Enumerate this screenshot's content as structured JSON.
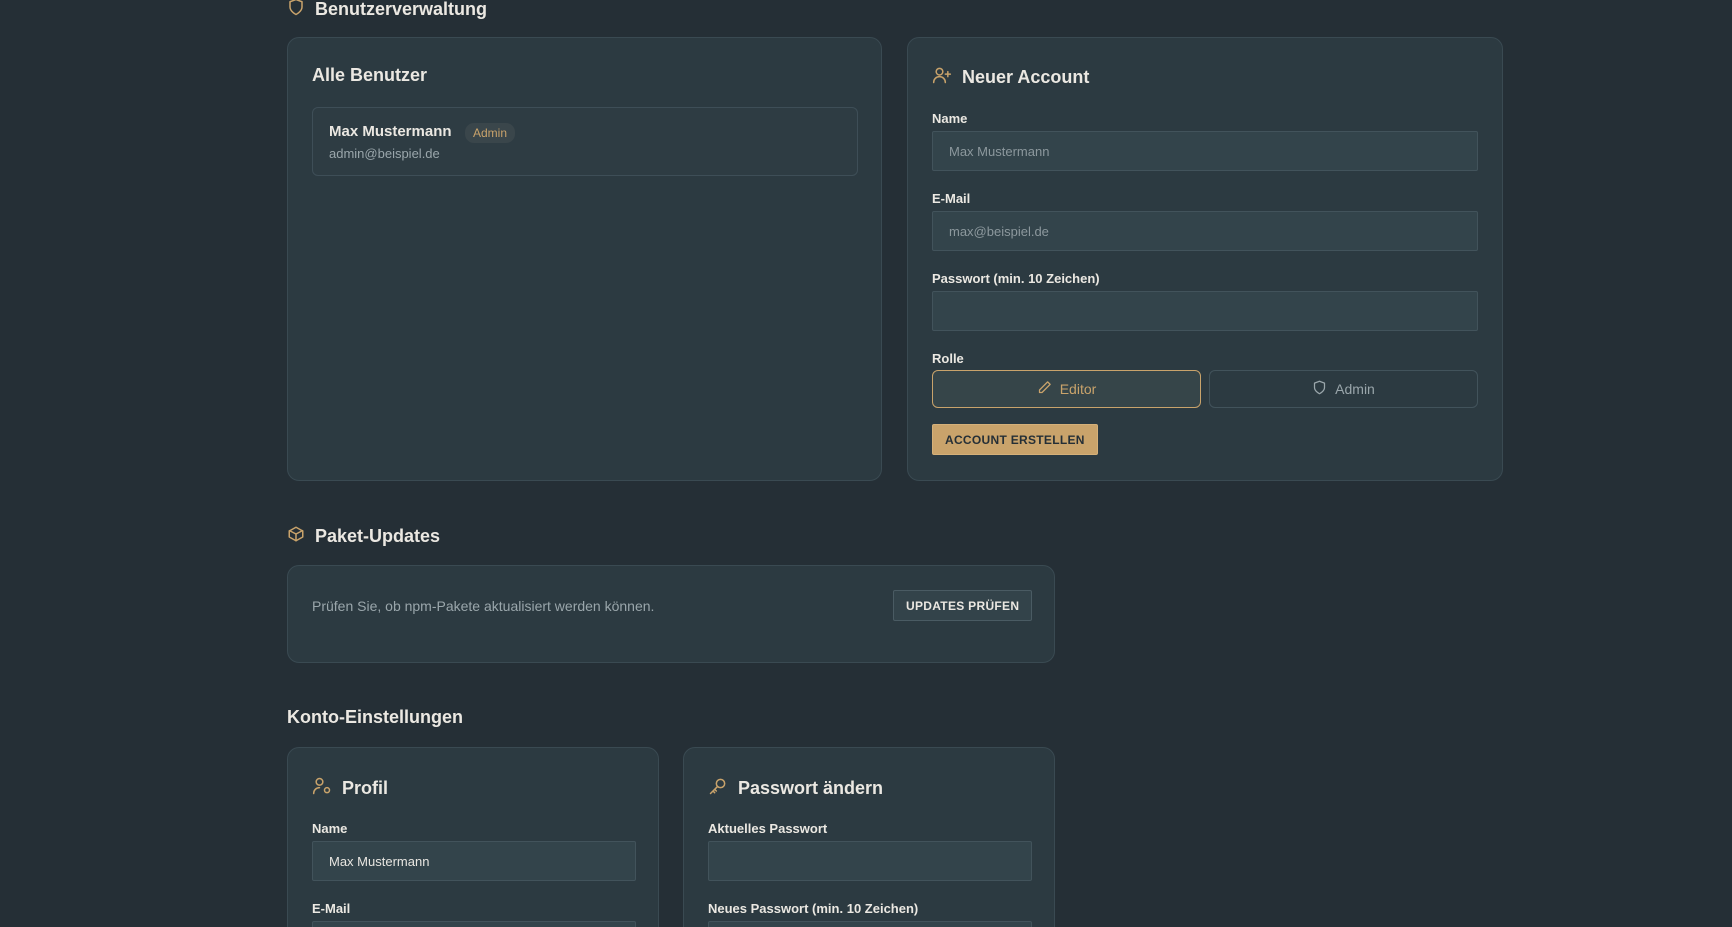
{
  "sections": {
    "user_management": "Benutzerverwaltung",
    "package_updates": "Paket-Updates",
    "account_settings": "Konto-Einstellungen"
  },
  "all_users": {
    "title": "Alle Benutzer",
    "users": [
      {
        "name": "Max Mustermann",
        "badge": "Admin",
        "email": "admin@beispiel.de"
      }
    ]
  },
  "new_account": {
    "title": "Neuer Account",
    "name_label": "Name",
    "name_placeholder": "Max Mustermann",
    "email_label": "E-Mail",
    "email_placeholder": "max@beispiel.de",
    "password_label": "Passwort (min. 10 Zeichen)",
    "role_label": "Rolle",
    "role_editor": "Editor",
    "role_admin": "Admin",
    "selected_role": "Editor",
    "submit_label": "ACCOUNT ERSTELLEN"
  },
  "updates": {
    "description": "Prüfen Sie, ob npm-Pakete aktualisiert werden können.",
    "button_label": "UPDATES PRÜFEN"
  },
  "profile": {
    "title": "Profil",
    "name_label": "Name",
    "name_value": "Max Mustermann",
    "email_label": "E-Mail"
  },
  "change_password": {
    "title": "Passwort ändern",
    "current_label": "Aktuelles Passwort",
    "new_label": "Neues Passwort (min. 10 Zeichen)"
  },
  "colors": {
    "background": "#252f36",
    "card": "#2c3a41",
    "accent": "#c9a36b",
    "text": "#ebe8e2",
    "muted": "#9aa6ab"
  },
  "icons": {
    "user_management": "shield-icon",
    "new_account": "user-plus-icon",
    "editor": "pencil-icon",
    "admin": "shield-icon",
    "package_updates": "package-icon",
    "profile": "user-cog-icon",
    "change_password": "key-icon"
  }
}
